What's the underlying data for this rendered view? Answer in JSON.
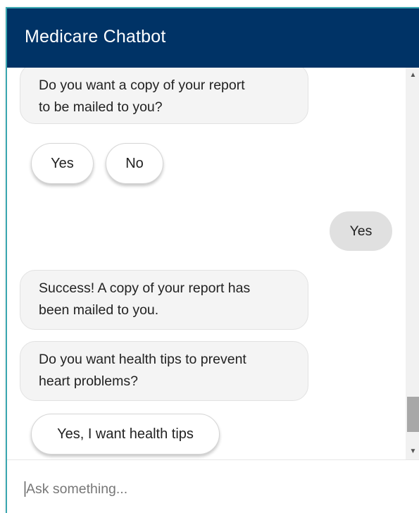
{
  "header": {
    "title": "Medicare Chatbot"
  },
  "messages": {
    "mail_prompt": {
      "line1": "Do you want a copy of your report",
      "line2": "to be mailed to you?"
    },
    "mail_options": {
      "yes": "Yes",
      "no": "No"
    },
    "user_reply": "Yes",
    "success": {
      "line1": "Success! A copy of your report has",
      "line2": "been mailed to you."
    },
    "tips_prompt": {
      "line1": "Do you want health tips to prevent",
      "line2": "heart problems?"
    },
    "tips_option": "Yes, I want health tips"
  },
  "scrollbar": {
    "up_icon": "triangle-up",
    "down_icon": "triangle-down",
    "thumb_position": 0.92
  },
  "input": {
    "placeholder": "Ask something..."
  },
  "colors": {
    "header_bg": "#003366",
    "accent": "#3aa6b0",
    "bot_bubble": "#f4f4f4",
    "user_bubble": "#e0e0e0"
  }
}
